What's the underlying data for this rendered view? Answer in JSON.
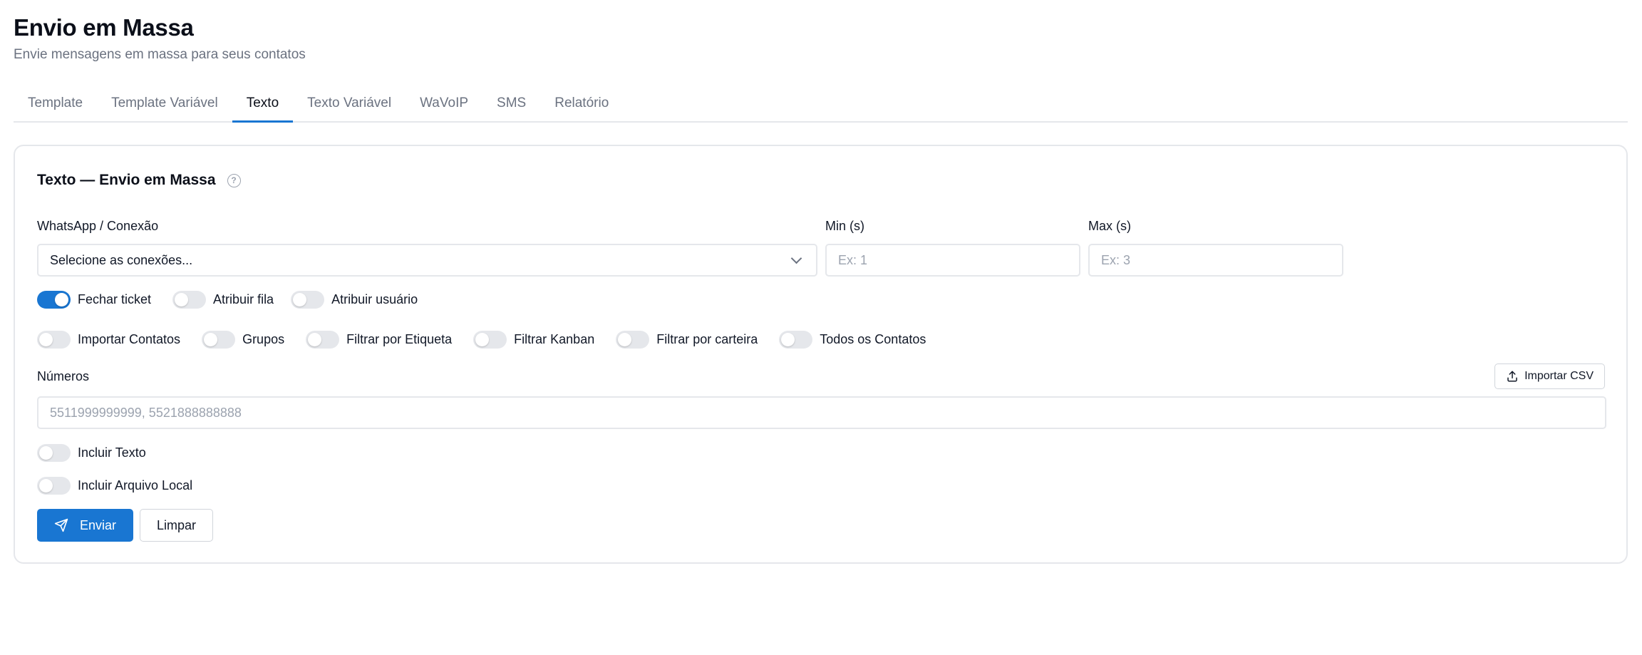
{
  "header": {
    "title": "Envio em Massa",
    "subtitle": "Envie mensagens em massa para seus contatos"
  },
  "tabs": [
    {
      "label": "Template",
      "active": false
    },
    {
      "label": "Template Variável",
      "active": false
    },
    {
      "label": "Texto",
      "active": true
    },
    {
      "label": "Texto Variável",
      "active": false
    },
    {
      "label": "WaVoIP",
      "active": false
    },
    {
      "label": "SMS",
      "active": false
    },
    {
      "label": "Relatório",
      "active": false
    }
  ],
  "card": {
    "title": "Texto — Envio em Massa",
    "help_icon": "question-circle-icon"
  },
  "form": {
    "connection": {
      "label": "WhatsApp / Conexão",
      "value": "Selecione as conexões..."
    },
    "min": {
      "label": "Min (s)",
      "placeholder": "Ex: 1"
    },
    "max": {
      "label": "Max (s)",
      "placeholder": "Ex: 3"
    },
    "toggles_row1": [
      {
        "label": "Fechar ticket",
        "on": true
      },
      {
        "label": "Atribuir fila",
        "on": false
      },
      {
        "label": "Atribuir usuário",
        "on": false
      }
    ],
    "toggles_row2": [
      {
        "label": "Importar Contatos",
        "on": false
      },
      {
        "label": "Grupos",
        "on": false
      },
      {
        "label": "Filtrar por Etiqueta",
        "on": false
      },
      {
        "label": "Filtrar Kanban",
        "on": false
      },
      {
        "label": "Filtrar por carteira",
        "on": false
      },
      {
        "label": "Todos os Contatos",
        "on": false
      }
    ],
    "numbers": {
      "label": "Números",
      "placeholder": "5511999999999, 5521888888888",
      "import_label": "Importar CSV"
    },
    "include_text": {
      "label": "Incluir Texto",
      "on": false
    },
    "include_file": {
      "label": "Incluir Arquivo Local",
      "on": false
    }
  },
  "actions": {
    "send_label": "Enviar",
    "clear_label": "Limpar"
  },
  "colors": {
    "accent": "#1976d2",
    "border": "#e5e7eb",
    "muted_text": "#6b7280"
  }
}
